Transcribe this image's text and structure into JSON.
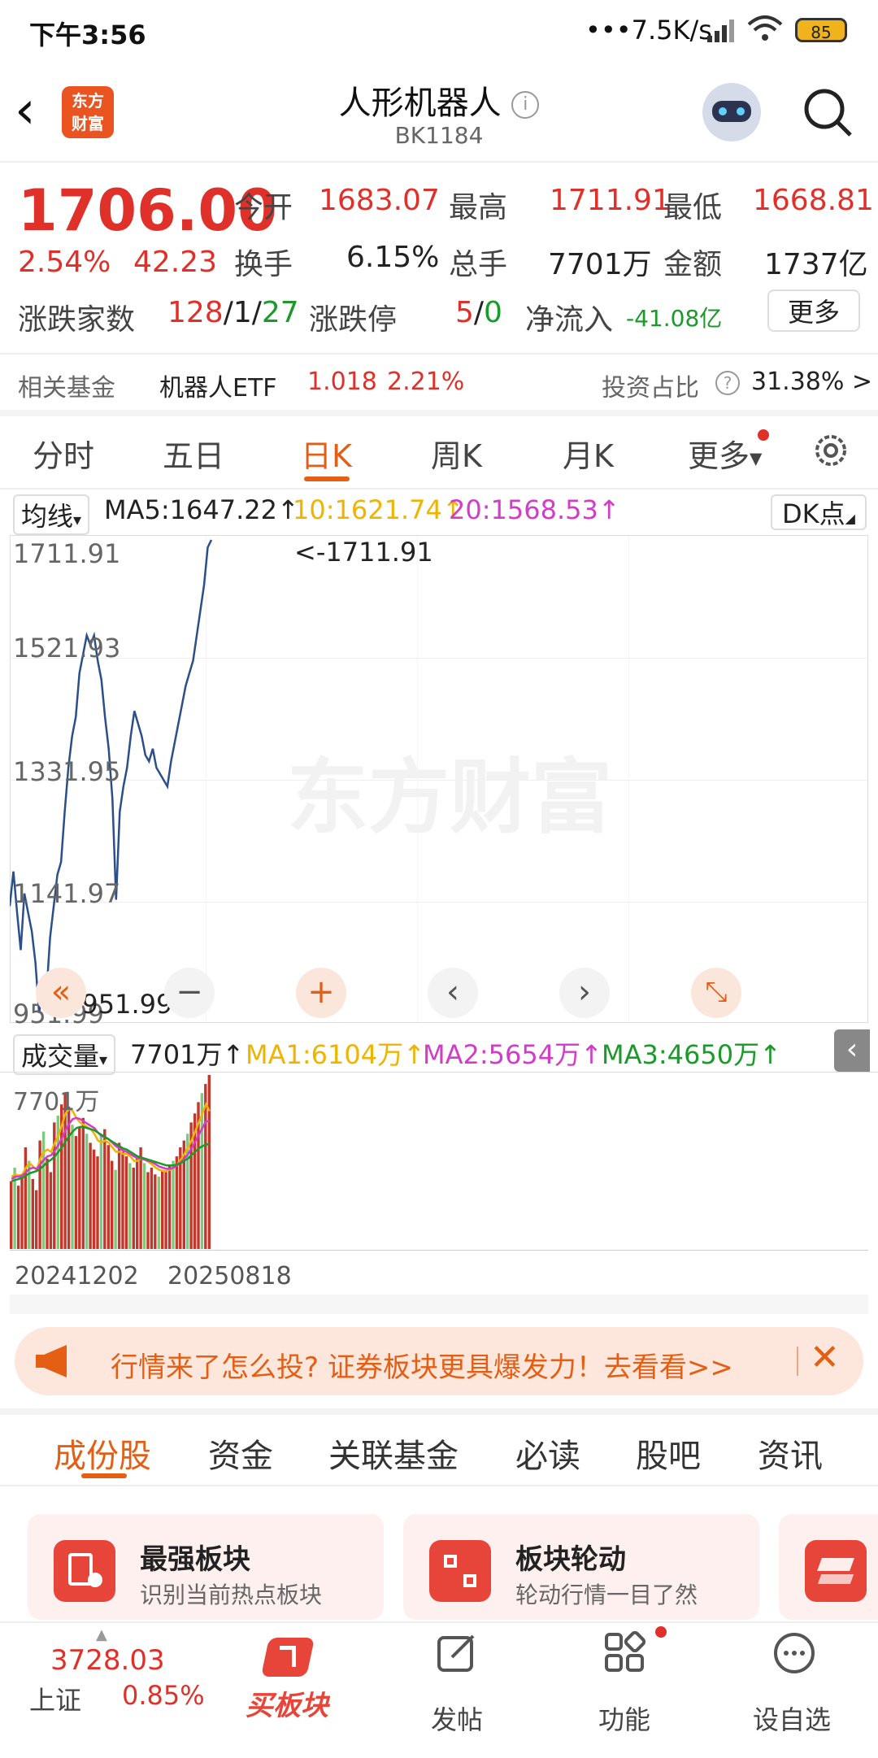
{
  "status_bar": {
    "time": "下午3:56",
    "network": "•••7.5K/s",
    "battery": "85"
  },
  "header": {
    "title": "人形机器人",
    "code": "BK1184",
    "logo_text": "东方财富"
  },
  "quote": {
    "price": "1706.00",
    "change_pct": "2.54%",
    "change_amt": "42.23",
    "open_label": "今开",
    "open": "1683.07",
    "high_label": "最高",
    "high": "1711.91",
    "low_label": "最低",
    "low": "1668.81",
    "turnover_label": "换手",
    "turnover": "6.15%",
    "volume_label": "总手",
    "volume": "7701万",
    "amount_label": "金额",
    "amount": "1737亿",
    "breadth_label": "涨跌家数",
    "breadth_up": "128",
    "breadth_flat": "1",
    "breadth_down": "27",
    "limit_label": "涨跌停",
    "limit_up": "5",
    "limit_down": "0",
    "inflow_label": "净流入",
    "inflow": "-41.08亿",
    "more_label": "更多"
  },
  "fund": {
    "label": "相关基金",
    "name": "机器人ETF",
    "price": "1.018",
    "pct": "2.21%",
    "ratio_label": "投资占比",
    "ratio": "31.38% >"
  },
  "chart_tabs": [
    "分时",
    "五日",
    "日K",
    "周K",
    "月K",
    "更多"
  ],
  "ma_bar": {
    "selector": "均线",
    "ma5": "MA5:1647.22",
    "ma10": "10:1621.74",
    "ma20": "20:1568.53",
    "dk": "DK点"
  },
  "vol_bar": {
    "selector": "成交量",
    "vol": "7701万",
    "ma1": "MA1:6104万",
    "ma2": "MA2:5654万",
    "ma3": "MA3:4650万"
  },
  "colors": {
    "accent": "#e45e14",
    "up": "#e0302a",
    "down": "#1a9a2a",
    "line": "#2a4f8a",
    "ma1": "#f0b400",
    "ma2": "#d23cc8",
    "ma3": "#1a9a2a"
  },
  "chart_data": {
    "type": "line",
    "y_ticks": [
      "1711.91",
      "1521.93",
      "1331.95",
      "1141.97",
      "951.99"
    ],
    "ylim": [
      951.99,
      1711.91
    ],
    "max_label": "<-1711.91",
    "min_label": "<-951.99",
    "watermark": "东方财富",
    "x_labels": [
      "20241202",
      "20250818"
    ],
    "series": [
      {
        "values": [
          1130,
          1185,
          1120,
          1060,
          1150,
          1120,
          1090,
          1040,
          960,
          1000,
          990,
          1080,
          1130,
          1180,
          1200,
          1280,
          1350,
          1400,
          1430,
          1500,
          1530,
          1560,
          1545,
          1560,
          1520,
          1490,
          1430,
          1380,
          1300,
          1140,
          1280,
          1320,
          1350,
          1400,
          1440,
          1420,
          1400,
          1370,
          1360,
          1380,
          1350,
          1340,
          1330,
          1320,
          1360,
          1390,
          1420,
          1450,
          1480,
          1500,
          1520,
          1560,
          1600,
          1640,
          1700,
          1711.91
        ]
      }
    ],
    "volume": {
      "label": "7701万",
      "max": 7701,
      "values": [
        3000,
        3600,
        2800,
        3200,
        4500,
        3900,
        3100,
        2600,
        4800,
        5200,
        4000,
        3400,
        5600,
        5900,
        6400,
        6900,
        6300,
        5500,
        5000,
        5400,
        5800,
        5100,
        4700,
        4400,
        4100,
        5000,
        5300,
        4600,
        3900,
        3500,
        4700,
        4300,
        4100,
        3800,
        3600,
        4000,
        4500,
        3800,
        3400,
        3600,
        3300,
        3200,
        3500,
        3400,
        3700,
        3900,
        4100,
        4500,
        4800,
        5100,
        5600,
        6000,
        6500,
        6900,
        7300,
        7701
      ],
      "ma1": [
        3200,
        3300,
        3250,
        3300,
        3600,
        3800,
        3650,
        3500,
        4000,
        4300,
        4400,
        4300,
        4700,
        5000,
        5500,
        6000,
        6200,
        6100,
        5800,
        5600,
        5500,
        5400,
        5300,
        5100,
        4800,
        4700,
        4800,
        4700,
        4500,
        4300,
        4300,
        4200,
        4200,
        4100,
        3900,
        3900,
        4000,
        3950,
        3850,
        3750,
        3600,
        3500,
        3450,
        3450,
        3500,
        3600,
        3750,
        3950,
        4200,
        4500,
        4800,
        5200,
        5600,
        6000,
        6400,
        6104
      ],
      "ma2": [
        3100,
        3200,
        3200,
        3250,
        3400,
        3550,
        3600,
        3550,
        3750,
        3950,
        4100,
        4150,
        4350,
        4600,
        4900,
        5250,
        5550,
        5750,
        5800,
        5750,
        5650,
        5550,
        5450,
        5350,
        5150,
        5000,
        4950,
        4850,
        4700,
        4550,
        4450,
        4350,
        4300,
        4200,
        4100,
        4000,
        4000,
        3950,
        3900,
        3850,
        3750,
        3650,
        3600,
        3550,
        3550,
        3600,
        3700,
        3850,
        4000,
        4200,
        4450,
        4750,
        5050,
        5350,
        5650,
        5654
      ],
      "ma3": [
        3000,
        3050,
        3100,
        3150,
        3250,
        3350,
        3400,
        3450,
        3550,
        3700,
        3850,
        3950,
        4100,
        4300,
        4500,
        4750,
        5000,
        5200,
        5350,
        5400,
        5400,
        5350,
        5300,
        5250,
        5150,
        5050,
        4950,
        4850,
        4750,
        4650,
        4550,
        4450,
        4400,
        4300,
        4200,
        4100,
        4050,
        4000,
        3950,
        3900,
        3850,
        3800,
        3750,
        3700,
        3700,
        3700,
        3750,
        3800,
        3900,
        4000,
        4150,
        4300,
        4450,
        4550,
        4620,
        4650
      ]
    }
  },
  "banner": {
    "text": "行情来了怎么投? 证券板块更具爆发力！去看看>>"
  },
  "bottom_tabs": [
    "成份股",
    "资金",
    "关联基金",
    "必读",
    "股吧",
    "资讯"
  ],
  "cards": [
    {
      "title": "最强板块",
      "sub": "识别当前热点板块"
    },
    {
      "title": "板块轮动",
      "sub": "轮动行情一目了然"
    }
  ],
  "bottom_bar": {
    "index_value": "3728.03",
    "index_name": "上证",
    "index_pct": "0.85%",
    "buy_label": "买板块",
    "post_label": "发帖",
    "func_label": "功能",
    "watch_label": "设自选"
  }
}
